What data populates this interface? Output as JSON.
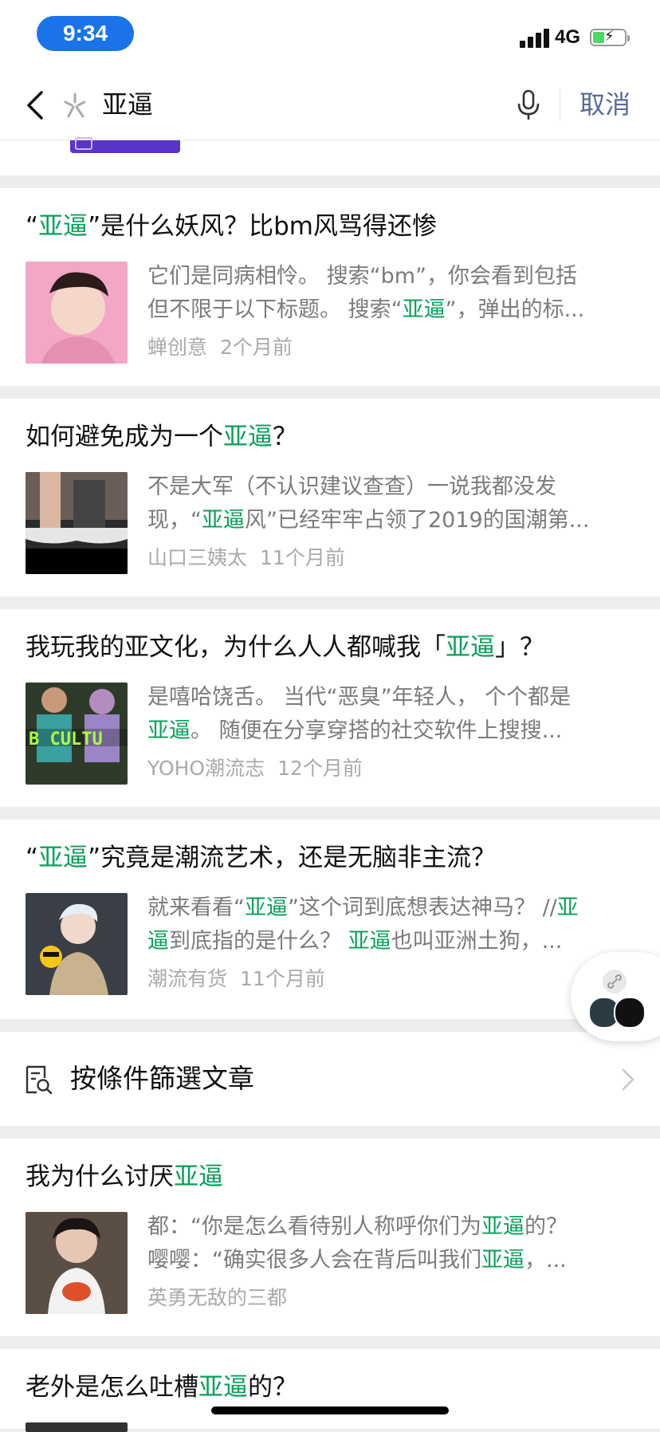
{
  "status_bar": {
    "time": "9:34",
    "network": "4G"
  },
  "search": {
    "query": "亚逼",
    "cancel_label": "取消"
  },
  "results": [
    {
      "title": [
        {
          "t": "“"
        },
        {
          "t": "亚逼",
          "hl": true
        },
        {
          "t": "”是什么妖风？比bm风骂得还惨"
        }
      ],
      "snippet_line1": [
        {
          "t": "它们是同病相怜。 搜索“bm”，你会看到包括"
        }
      ],
      "snippet_line2": [
        {
          "t": "但不限于以下标题。 搜索“"
        },
        {
          "t": "亚逼",
          "hl": true
        },
        {
          "t": "”，弹出的标..."
        }
      ],
      "author": "蝉创意",
      "time": "2个月前"
    },
    {
      "title": [
        {
          "t": "如何避免成为一个"
        },
        {
          "t": "亚逼",
          "hl": true
        },
        {
          "t": "？"
        }
      ],
      "snippet_line1": [
        {
          "t": "不是大军（不认识建议查查）一说我都没发"
        }
      ],
      "snippet_line2": [
        {
          "t": "现，“"
        },
        {
          "t": "亚逼",
          "hl": true
        },
        {
          "t": "风”已经牢牢占领了2019的国潮第..."
        }
      ],
      "author": "山口三姨太",
      "time": "11个月前"
    },
    {
      "title": [
        {
          "t": "我玩我的亚文化，为什么人人都喊我「"
        },
        {
          "t": "亚逼",
          "hl": true
        },
        {
          "t": "」？"
        }
      ],
      "snippet_line1": [
        {
          "t": "是嘻哈饶舌。 当代“恶臭”年轻人， 个个都是"
        }
      ],
      "snippet_line2": [
        {
          "t": "亚逼",
          "hl": true
        },
        {
          "t": "。 随便在分享穿搭的社交软件上搜搜..."
        }
      ],
      "author": "YOHO潮流志",
      "time": "12个月前"
    },
    {
      "title": [
        {
          "t": "“"
        },
        {
          "t": "亚逼",
          "hl": true
        },
        {
          "t": "”究竟是潮流艺术，还是无脑非主流？"
        }
      ],
      "snippet_line1": [
        {
          "t": "就来看看“"
        },
        {
          "t": "亚逼",
          "hl": true
        },
        {
          "t": "”这个词到底想表达神马？ //"
        },
        {
          "t": "亚",
          "hl": true
        }
      ],
      "snippet_line2": [
        {
          "t": "逼",
          "hl": true
        },
        {
          "t": "到底指的是什么？ "
        },
        {
          "t": "亚逼",
          "hl": true
        },
        {
          "t": "也叫亚洲土狗，..."
        }
      ],
      "author": "潮流有货",
      "time": "11个月前"
    },
    {
      "title": [
        {
          "t": "我为什么讨厌"
        },
        {
          "t": "亚逼",
          "hl": true
        }
      ],
      "snippet_line1": [
        {
          "t": "都：“你是怎么看待别人称呼你们为"
        },
        {
          "t": "亚逼",
          "hl": true
        },
        {
          "t": "的？"
        }
      ],
      "snippet_line2": [
        {
          "t": "嘤嘤：“确实很多人会在背后叫我们"
        },
        {
          "t": "亚逼",
          "hl": true
        },
        {
          "t": "，..."
        }
      ],
      "author": "英勇无敌的三都",
      "time": ""
    },
    {
      "title": [
        {
          "t": "老外是怎么吐槽"
        },
        {
          "t": "亚逼",
          "hl": true
        },
        {
          "t": "的？"
        }
      ]
    }
  ],
  "filter": {
    "label": "按條件篩選文章"
  },
  "colors": {
    "highlight": "#07a05a",
    "cancel": "#576b95",
    "time_pill": "#1a73e8"
  },
  "icons": [
    "back-icon",
    "search-mark-icon",
    "mic-icon",
    "filter-search-icon",
    "chevron-right-icon",
    "link-icon"
  ]
}
